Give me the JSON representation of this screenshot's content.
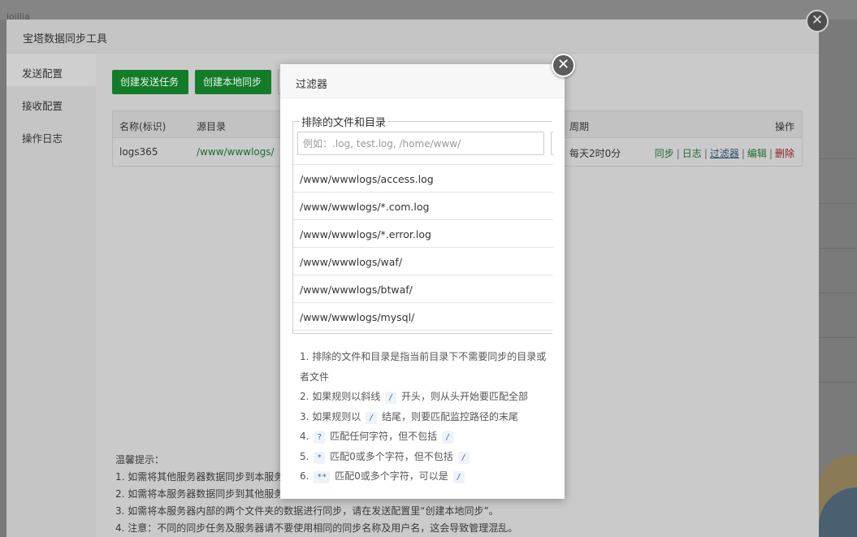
{
  "background": {
    "top_text": "ioiilia"
  },
  "tool": {
    "title": "宝塔数据同步工具",
    "sidebar": [
      {
        "label": "发送配置",
        "active": true
      },
      {
        "label": "接收配置",
        "active": false
      },
      {
        "label": "操作日志",
        "active": false
      }
    ],
    "buttons": {
      "create_send_task": "创建发送任务",
      "create_local_sync": "创建本地同步"
    },
    "table": {
      "headers": {
        "name": "名称(标识)",
        "source_dir": "源目录",
        "cycle": "周期",
        "action": "操作"
      },
      "rows": [
        {
          "name": "logs365",
          "source_dir": "/www/wwwlogs/",
          "cycle": "每天2时0分",
          "actions": {
            "sync": "同步",
            "log": "日志",
            "filter": "过滤器",
            "edit": "编辑",
            "delete": "删除"
          }
        }
      ]
    },
    "tips": {
      "title": "温馨提示：",
      "lines": [
        "1. 如需将其他服务器数据同步到本服务",
        "2. 如需将本服务器数据同步到其他服务",
        "3. 如需将本服务器内部的两个文件夹的数据进行同步，请在发送配置里“创建本地同步”。",
        "4. 注意：不同的同步任务及服务器请不要使用相同的同步名称及用户名，这会导致管理混乱。"
      ]
    }
  },
  "filter_dialog": {
    "title": "过滤器",
    "legend": "排除的文件和目录",
    "input_placeholder": "例如：.log, test.log, /home/www/",
    "paths": [
      "/www/wwwlogs/access.log",
      "/www/wwwlogs/*.com.log",
      "/www/wwwlogs/*.error.log",
      "/www/wwwlogs/waf/",
      "/www/wwwlogs/btwaf/",
      "/www/wwwlogs/mysql/"
    ],
    "rules": {
      "r1": "1. 排除的文件和目录是指当前目录下不需要同步的目录或者文件",
      "r2_pre": "2. 如果规则以斜线",
      "r2_code": "/",
      "r2_post": "开头，则从头开始要匹配全部",
      "r3_pre": "3. 如果规则以",
      "r3_code": "/",
      "r3_post": "结尾，则要匹配监控路径的末尾",
      "r4_num": "4.",
      "r4_code1": "?",
      "r4_mid": "匹配任何字符，但不包括",
      "r4_code2": "/",
      "r5_num": "5.",
      "r5_code1": "*",
      "r5_mid": "匹配0或多个字符，但不包括",
      "r5_code2": "/",
      "r6_num": "6.",
      "r6_code1": "**",
      "r6_mid": "匹配0或多个字符，可以是",
      "r6_code2": "/"
    }
  },
  "colors": {
    "green_button": "#20a53a",
    "link_green": "#20a53a",
    "link_red": "#ef0808",
    "code_blue": "#3d6ea3"
  }
}
